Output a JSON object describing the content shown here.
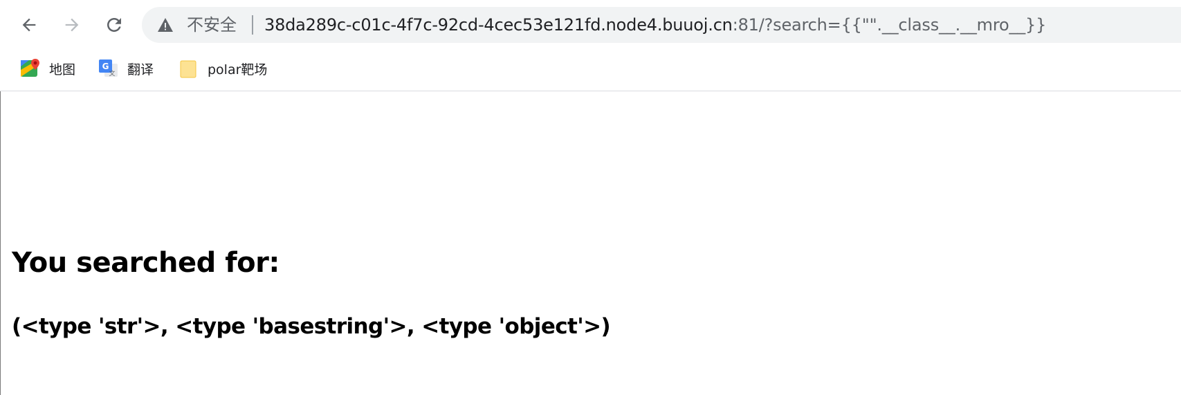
{
  "browser": {
    "security_label": "不安全",
    "url_host": "38da289c-c01c-4f7c-92cd-4cec53e121fd.node4.buuoj.cn",
    "url_rest": ":81/?search={{\"\".__class__.__mro__}}"
  },
  "bookmarks": [
    {
      "label": "地图",
      "icon": "maps-icon"
    },
    {
      "label": "翻译",
      "icon": "translate-icon"
    },
    {
      "label": "polar靶场",
      "icon": "folder-icon"
    }
  ],
  "page": {
    "heading": "You searched for:",
    "result": "(<type 'str'>, <type 'basestring'>, <type 'object'>)"
  },
  "colors": {
    "omnibox_bg": "#f1f3f4",
    "url_host": "#202124",
    "url_rest": "#5f6368",
    "folder": "#fde293"
  }
}
